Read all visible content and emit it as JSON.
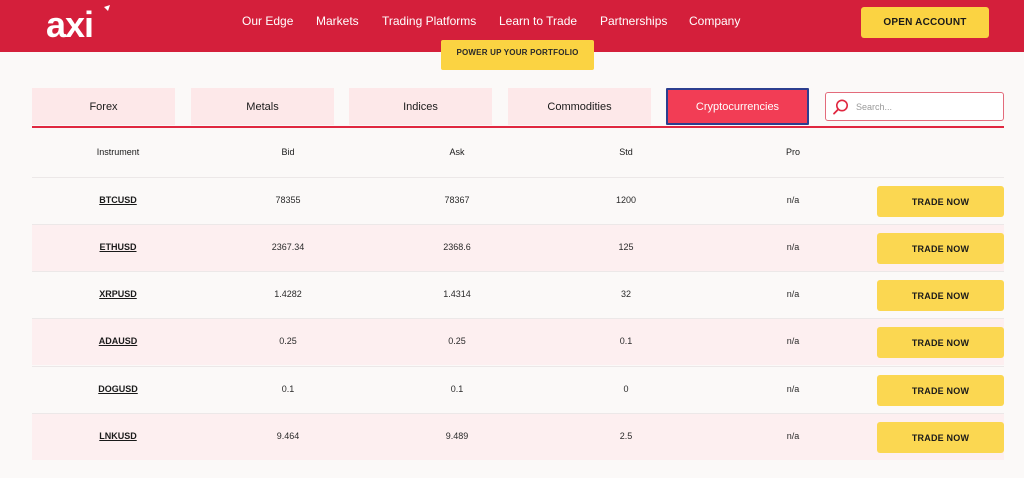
{
  "brand": {
    "logo_text": "axi",
    "accent": "#d41f3b",
    "cta_color": "#fbd342"
  },
  "nav": {
    "items": [
      "Our Edge",
      "Markets",
      "Trading Platforms",
      "Learn to Trade",
      "Partnerships",
      "Company"
    ],
    "open_account": "OPEN ACCOUNT"
  },
  "promo": {
    "label": "POWER UP YOUR PORTFOLIO"
  },
  "tabs": {
    "items": [
      "Forex",
      "Metals",
      "Indices",
      "Commodities",
      "Cryptocurrencies"
    ],
    "active": "Cryptocurrencies"
  },
  "search": {
    "placeholder": "Search..."
  },
  "table": {
    "headers": [
      "Instrument",
      "Bid",
      "Ask",
      "Std",
      "Pro"
    ],
    "trade_label": "TRADE NOW",
    "rows": [
      {
        "instrument": "BTCUSD",
        "bid": "78355",
        "ask": "78367",
        "std": "1200",
        "pro": "n/a"
      },
      {
        "instrument": "ETHUSD",
        "bid": "2367.34",
        "ask": "2368.6",
        "std": "125",
        "pro": "n/a"
      },
      {
        "instrument": "XRPUSD",
        "bid": "1.4282",
        "ask": "1.4314",
        "std": "32",
        "pro": "n/a"
      },
      {
        "instrument": "ADAUSD",
        "bid": "0.25",
        "ask": "0.25",
        "std": "0.1",
        "pro": "n/a"
      },
      {
        "instrument": "DOGUSD",
        "bid": "0.1",
        "ask": "0.1",
        "std": "0",
        "pro": "n/a"
      },
      {
        "instrument": "LNKUSD",
        "bid": "9.464",
        "ask": "9.489",
        "std": "2.5",
        "pro": "n/a"
      }
    ]
  }
}
